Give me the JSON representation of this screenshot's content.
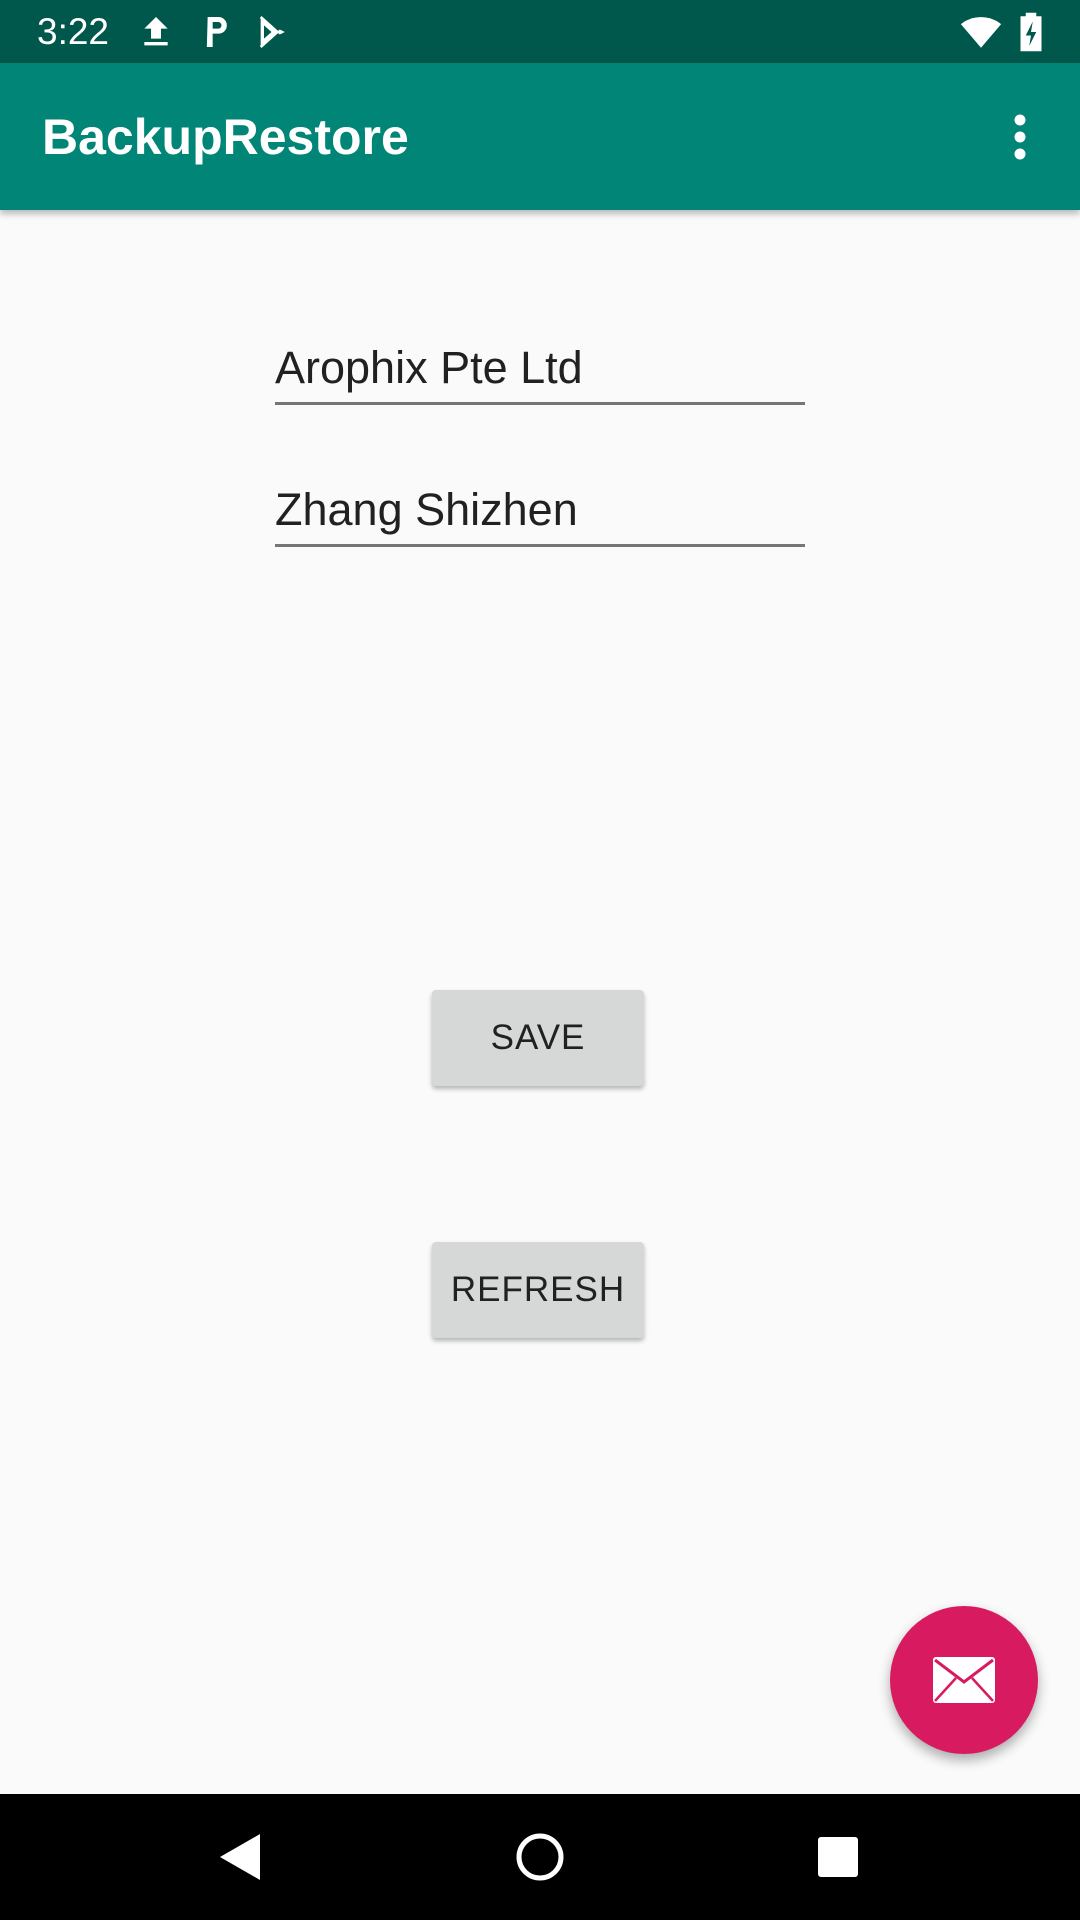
{
  "status_bar": {
    "time": "3:22",
    "icons": [
      "upload-icon",
      "parking-icon",
      "play-store-icon",
      "wifi-icon",
      "battery-charging-icon"
    ]
  },
  "app_bar": {
    "title": "BackupRestore",
    "overflow_icon": "more-vert-icon"
  },
  "form": {
    "company_value": "Arophix Pte Ltd",
    "name_value": "Zhang Shizhen"
  },
  "buttons": {
    "save_label": "SAVE",
    "refresh_label": "REFRESH"
  },
  "fab": {
    "icon": "email-icon"
  },
  "nav_bar": {
    "icons": [
      "back-icon",
      "home-icon",
      "recents-icon"
    ]
  },
  "colors": {
    "status_bar": "#00574b",
    "app_bar": "#008577",
    "fab": "#d81b60",
    "background": "#fafafa",
    "button": "#d6d7d7"
  }
}
